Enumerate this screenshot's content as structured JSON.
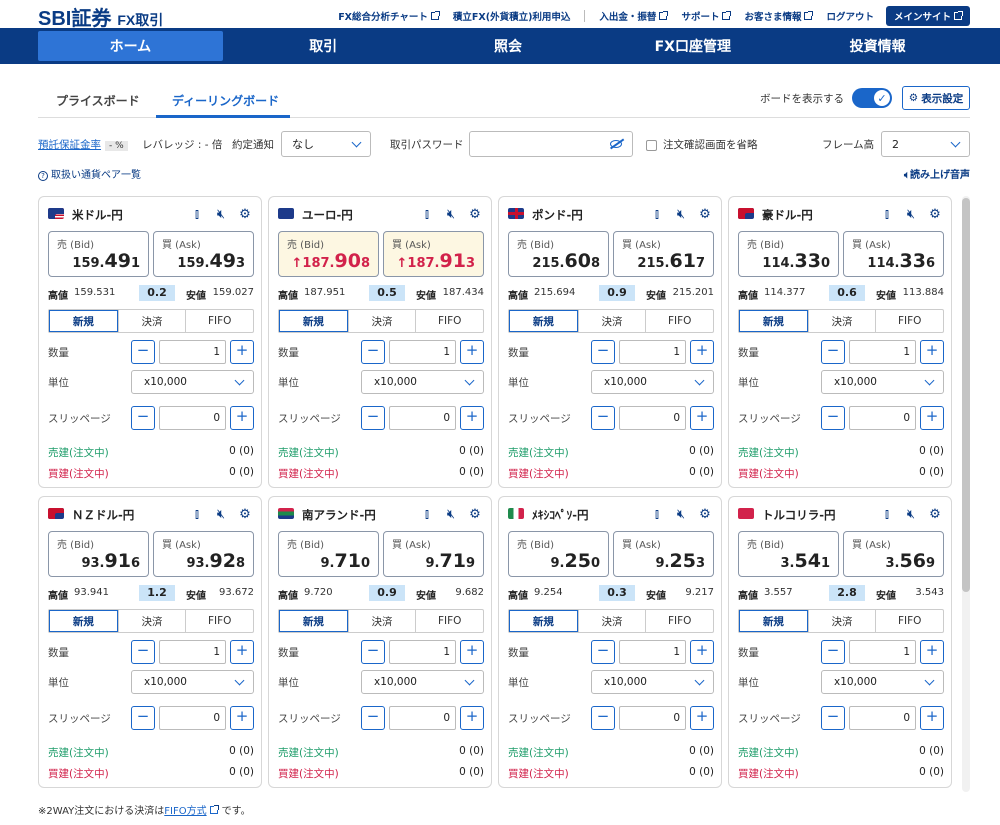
{
  "header": {
    "logo": "SBI証券",
    "logo_sub": "FX取引",
    "links": [
      "FX総合分析チャート",
      "積立FX(外貨積立)利用申込",
      "入出金・振替",
      "サポート",
      "お客さま情報",
      "ログアウト"
    ],
    "main_site": "メインサイト"
  },
  "nav": [
    "ホーム",
    "取引",
    "照会",
    "FX口座管理",
    "投資情報"
  ],
  "tabs": {
    "price_board": "プライスボード",
    "dealing_board": "ディーリングボード"
  },
  "board_toggle_label": "ボードを表示する",
  "display_settings": "表示設定",
  "toolbar": {
    "margin_rate_label": "預託保証金率",
    "margin_rate_value": "- %",
    "leverage": "レバレッジ : - 倍",
    "contract_notice_label": "約定通知",
    "contract_notice_value": "なし",
    "password_label": "取引パスワード",
    "skip_confirm": "注文確認画面を省略",
    "frame_height_label": "フレーム高",
    "frame_height_value": "2"
  },
  "currency_list_link": "取扱い通貨ペア一覧",
  "read_aloud": "読み上げ音声",
  "labels": {
    "bid": "売 (Bid)",
    "ask": "買 (Ask)",
    "high": "高値",
    "low": "安値",
    "new": "新規",
    "settle": "決済",
    "fifo": "FIFO",
    "quantity": "数量",
    "unit": "単位",
    "slippage": "スリッページ",
    "sell_open": "売建(注文中)",
    "buy_open": "買建(注文中)"
  },
  "cards": [
    {
      "name": "米ドル-円",
      "flag": "us",
      "bid_pre": "159.",
      "bid_big": "49",
      "bid_last": "1",
      "ask_pre": "159.",
      "ask_big": "49",
      "ask_last": "3",
      "high": "159.531",
      "spread": "0.2",
      "low": "159.027",
      "qty": "1",
      "unit": "x10,000",
      "slip": "0",
      "sell_open": "0 (0)",
      "buy_open": "0 (0)",
      "up": false
    },
    {
      "name": "ユーロ-円",
      "flag": "eu",
      "bid_pre": "↑187.",
      "bid_big": "90",
      "bid_last": "8",
      "ask_pre": "↑187.",
      "ask_big": "91",
      "ask_last": "3",
      "high": "187.951",
      "spread": "0.5",
      "low": "187.434",
      "qty": "1",
      "unit": "x10,000",
      "slip": "0",
      "sell_open": "0 (0)",
      "buy_open": "0 (0)",
      "up": true
    },
    {
      "name": "ポンド-円",
      "flag": "gb",
      "bid_pre": "215.",
      "bid_big": "60",
      "bid_last": "8",
      "ask_pre": "215.",
      "ask_big": "61",
      "ask_last": "7",
      "high": "215.694",
      "spread": "0.9",
      "low": "215.201",
      "qty": "1",
      "unit": "x10,000",
      "slip": "0",
      "sell_open": "0 (0)",
      "buy_open": "0 (0)",
      "up": false
    },
    {
      "name": "豪ドル-円",
      "flag": "au",
      "bid_pre": "114.",
      "bid_big": "33",
      "bid_last": "0",
      "ask_pre": "114.",
      "ask_big": "33",
      "ask_last": "6",
      "high": "114.377",
      "spread": "0.6",
      "low": "113.884",
      "qty": "1",
      "unit": "x10,000",
      "slip": "0",
      "sell_open": "0 (0)",
      "buy_open": "0 (0)",
      "up": false
    },
    {
      "name": "ＮＺドル-円",
      "flag": "nz",
      "bid_pre": "93.",
      "bid_big": "91",
      "bid_last": "6",
      "ask_pre": "93.",
      "ask_big": "92",
      "ask_last": "8",
      "high": "93.941",
      "spread": "1.2",
      "low": "93.672",
      "qty": "1",
      "unit": "x10,000",
      "slip": "0",
      "sell_open": "0 (0)",
      "buy_open": "0 (0)",
      "up": false
    },
    {
      "name": "南アランド-円",
      "flag": "za",
      "bid_pre": "9.",
      "bid_big": "71",
      "bid_last": "0",
      "ask_pre": "9.",
      "ask_big": "71",
      "ask_last": "9",
      "high": "9.720",
      "spread": "0.9",
      "low": "9.682",
      "qty": "1",
      "unit": "x10,000",
      "slip": "0",
      "sell_open": "0 (0)",
      "buy_open": "0 (0)",
      "up": false
    },
    {
      "name": "ﾒｷｼｺﾍﾟｿ-円",
      "flag": "mx",
      "bid_pre": "9.",
      "bid_big": "25",
      "bid_last": "0",
      "ask_pre": "9.",
      "ask_big": "25",
      "ask_last": "3",
      "high": "9.254",
      "spread": "0.3",
      "low": "9.217",
      "qty": "1",
      "unit": "x10,000",
      "slip": "0",
      "sell_open": "0 (0)",
      "buy_open": "0 (0)",
      "up": false
    },
    {
      "name": "トルコリラ-円",
      "flag": "tr",
      "bid_pre": "3.",
      "bid_big": "54",
      "bid_last": "1",
      "ask_pre": "3.",
      "ask_big": "56",
      "ask_last": "9",
      "high": "3.557",
      "spread": "2.8",
      "low": "3.543",
      "qty": "1",
      "unit": "x10,000",
      "slip": "0",
      "sell_open": "0 (0)",
      "buy_open": "0 (0)",
      "up": false
    }
  ],
  "footer": {
    "text_before": "※2WAY注文における決済は",
    "link": "FIFO方式",
    "text_after": "です。"
  },
  "colors": {
    "navy": "#0a3b84",
    "accent": "#1a66c9",
    "sell": "#1f9d6b",
    "buy": "#d2224b",
    "spread_bg": "#cbe4f8",
    "up_bg": "#fdf7e2"
  }
}
